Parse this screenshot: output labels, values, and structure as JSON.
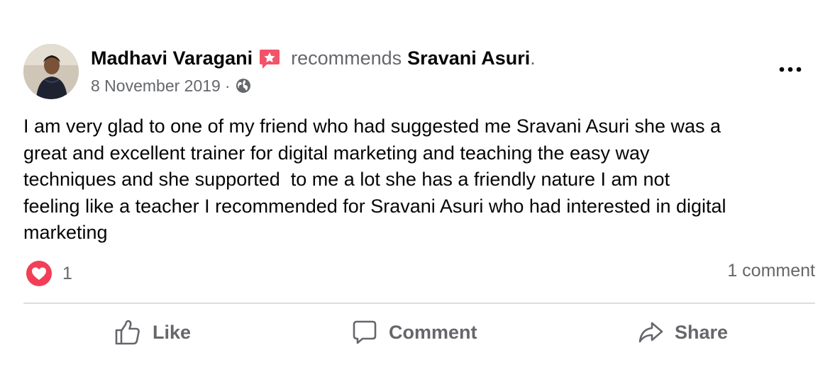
{
  "post": {
    "author": "Madhavi Varagani",
    "action_text": "recommends",
    "recommended_page": "Sravani Asuri",
    "trailing_punct": ".",
    "date": "8 November 2019",
    "separator": "·",
    "visibility_icon": "globe-icon",
    "badge_icon": "recommendation-star-icon",
    "more_icon": "more-dots-icon",
    "body": "I am very glad to one of my friend who had suggested me Sravani Asuri she was a great and excellent trainer for digital marketing and teaching the easy way techniques and she supported  to me a lot she has a friendly nature I am not feeling like a teacher I recommended for Sravani Asuri who had interested in digital marketing",
    "body_lines": [
      "I am very glad to one of my friend who had suggested me Sravani Asuri she was a",
      "great and excellent trainer for digital marketing and teaching the easy way",
      "techniques and she supported  to me a lot she has a friendly nature I am not",
      "feeling like a teacher I recommended for Sravani Asuri who had interested in digital",
      "marketing"
    ]
  },
  "summary": {
    "reaction_icon": "love-reaction-icon",
    "reaction_count": "1",
    "comment_count_text": "1 comment"
  },
  "actions": {
    "like_label": "Like",
    "comment_label": "Comment",
    "share_label": "Share"
  },
  "colors": {
    "primary_text": "#050505",
    "secondary_text": "#65676b",
    "badge_red": "#f35369",
    "love_red": "#f33e58",
    "divider": "#dadde1"
  }
}
